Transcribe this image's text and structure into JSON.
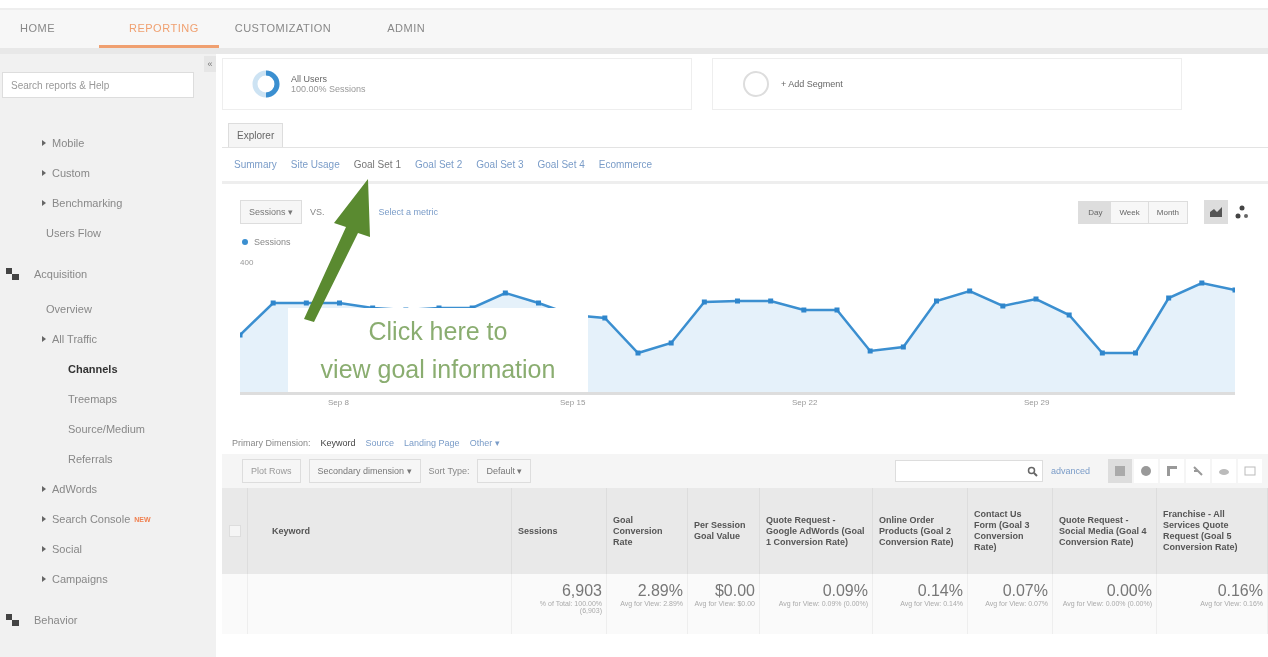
{
  "nav": {
    "tabs": [
      {
        "label": "HOME",
        "selected": false
      },
      {
        "label": "REPORTING",
        "selected": true
      },
      {
        "label": "CUSTOMIZATION",
        "selected": false
      },
      {
        "label": "ADMIN",
        "selected": false
      }
    ]
  },
  "sidebar": {
    "collapse": "«",
    "search": {
      "placeholder": "Search reports & Help"
    },
    "groups": [
      {
        "items": [
          {
            "label": "Mobile",
            "kind": "expandable",
            "selected": false
          },
          {
            "label": "Custom",
            "kind": "expandable",
            "selected": false
          },
          {
            "label": "Benchmarking",
            "kind": "expandable",
            "selected": false
          },
          {
            "label": "Users Flow",
            "kind": "link",
            "selected": false
          }
        ]
      },
      {
        "title": "Acquisition",
        "items": [
          {
            "label": "Overview",
            "kind": "link",
            "selected": false
          },
          {
            "label": "All Traffic",
            "kind": "expandable",
            "selected": false,
            "children": [
              {
                "label": "Channels",
                "kind": "link",
                "selected": true
              },
              {
                "label": "Treemaps",
                "kind": "link",
                "selected": false
              },
              {
                "label": "Source/Medium",
                "kind": "link",
                "selected": false
              },
              {
                "label": "Referrals",
                "kind": "link",
                "selected": false
              }
            ]
          },
          {
            "label": "AdWords",
            "kind": "expandable",
            "selected": false
          },
          {
            "label": "Search Console",
            "kind": "expandable",
            "selected": false,
            "badge": "NEW"
          },
          {
            "label": "Social",
            "kind": "expandable",
            "selected": false
          },
          {
            "label": "Campaigns",
            "kind": "expandable",
            "selected": false
          }
        ]
      },
      {
        "title": "Behavior"
      }
    ]
  },
  "segments": [
    {
      "kind": "segment",
      "name": "All Users",
      "detail": "100.00% Sessions"
    },
    {
      "kind": "add",
      "name": "+ Add Segment"
    }
  ],
  "explorer": {
    "tab": "Explorer",
    "subtabs": [
      {
        "label": "Summary",
        "selected": false
      },
      {
        "label": "Site Usage",
        "selected": false
      },
      {
        "label": "Goal Set 1",
        "selected": true
      },
      {
        "label": "Goal Set 2",
        "selected": false
      },
      {
        "label": "Goal Set 3",
        "selected": false
      },
      {
        "label": "Goal Set 4",
        "selected": false
      },
      {
        "label": "Ecommerce",
        "selected": false
      }
    ]
  },
  "chart_controls": {
    "metric": "Sessions",
    "metric_caret": "▾",
    "vs": "VS.",
    "compare": "Select a metric",
    "periods": [
      {
        "label": "Day",
        "selected": true
      },
      {
        "label": "Week",
        "selected": false
      },
      {
        "label": "Month",
        "selected": false
      }
    ],
    "chart_types": [
      {
        "kind": "line",
        "selected": true
      },
      {
        "kind": "motion",
        "selected": false
      }
    ]
  },
  "chart": {
    "legend": "Sessions",
    "y_label": "400",
    "x_labels": [
      "Sep 8",
      "Sep 15",
      "Sep 22",
      "Sep 29"
    ]
  },
  "callout": {
    "lines": [
      "Click here to",
      "view goal information"
    ]
  },
  "dimensions": {
    "label": "Primary Dimension:",
    "options": [
      {
        "label": "Keyword",
        "selected": true
      },
      {
        "label": "Source",
        "selected": false
      },
      {
        "label": "Landing Page",
        "selected": false
      },
      {
        "label": "Other ▾",
        "selected": false
      }
    ]
  },
  "toolbar": {
    "plot_rows": "Plot Rows",
    "secondary": "Secondary dimension ▾",
    "sort_label": "Sort Type:",
    "sort": "Default ▾",
    "advanced": "advanced",
    "views": [
      {
        "kind": "table",
        "selected": true
      },
      {
        "kind": "pie",
        "selected": false
      },
      {
        "kind": "bar",
        "selected": false
      },
      {
        "kind": "compare",
        "selected": false
      },
      {
        "kind": "term",
        "selected": false
      },
      {
        "kind": "pivot",
        "selected": false
      }
    ]
  },
  "table": {
    "select_all": {
      "checked": false
    },
    "columns": [
      {
        "label": "Keyword"
      },
      {
        "label": "Sessions"
      },
      {
        "label": "Goal Conversion Rate"
      },
      {
        "label": "Per Session Goal Value"
      },
      {
        "label": "Quote Request - Google AdWords (Goal 1 Conversion Rate)"
      },
      {
        "label": "Online Order Products (Goal 2 Conversion Rate)"
      },
      {
        "label": "Contact Us Form (Goal 3 Conversion Rate)"
      },
      {
        "label": "Quote Request - Social Media (Goal 4 Conversion Rate)"
      },
      {
        "label": "Franchise - All Services Quote Request (Goal 5 Conversion Rate)"
      }
    ],
    "totals": [
      {
        "value": "6,903",
        "note": "% of Total: 100.00% (6,903)"
      },
      {
        "value": "2.89%",
        "note": "Avg for View: 2.89%"
      },
      {
        "value": "$0.00",
        "note": "Avg for View: $0.00"
      },
      {
        "value": "0.09%",
        "note": "Avg for View: 0.09% (0.00%)"
      },
      {
        "value": "0.14%",
        "note": "Avg for View: 0.14%"
      },
      {
        "value": "0.07%",
        "note": "Avg for View: 0.07%"
      },
      {
        "value": "0.00%",
        "note": "Avg for View: 0.00% (0.00%)"
      },
      {
        "value": "0.16%",
        "note": "Avg for View: 0.16%"
      }
    ]
  }
}
